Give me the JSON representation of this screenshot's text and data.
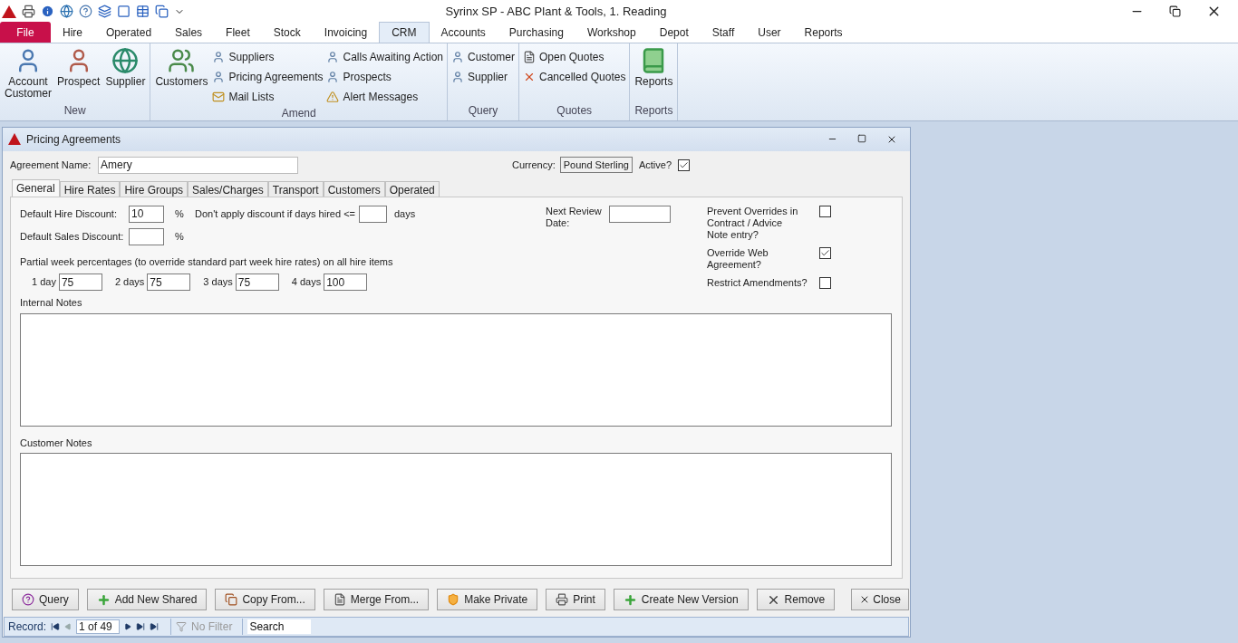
{
  "app_title": "Syrinx SP - ABC Plant & Tools, 1. Reading",
  "menu_tabs": [
    {
      "label": "File",
      "selected": false,
      "kind": "file"
    },
    {
      "label": "Hire",
      "selected": false,
      "kind": "tab"
    },
    {
      "label": "Operated",
      "selected": false,
      "kind": "tab"
    },
    {
      "label": "Sales",
      "selected": false,
      "kind": "tab"
    },
    {
      "label": "Fleet",
      "selected": false,
      "kind": "tab"
    },
    {
      "label": "Stock",
      "selected": false,
      "kind": "tab"
    },
    {
      "label": "Invoicing",
      "selected": false,
      "kind": "tab"
    },
    {
      "label": "CRM",
      "selected": true,
      "kind": "tab"
    },
    {
      "label": "Accounts",
      "selected": false,
      "kind": "tab"
    },
    {
      "label": "Purchasing",
      "selected": false,
      "kind": "tab"
    },
    {
      "label": "Workshop",
      "selected": false,
      "kind": "tab"
    },
    {
      "label": "Depot",
      "selected": false,
      "kind": "tab"
    },
    {
      "label": "Staff",
      "selected": false,
      "kind": "tab"
    },
    {
      "label": "User",
      "selected": false,
      "kind": "tab"
    },
    {
      "label": "Reports",
      "selected": false,
      "kind": "tab"
    }
  ],
  "ribbon_groups": [
    {
      "name": "New",
      "large": [
        "Account\nCustomer",
        "Prospect",
        "Supplier"
      ]
    },
    {
      "name": "Amend",
      "large": [
        "Customers"
      ],
      "small_columns": [
        [
          "Suppliers",
          "Pricing Agreements",
          "Mail Lists"
        ],
        [
          "Calls Awaiting Action",
          "Prospects",
          "Alert Messages"
        ]
      ]
    },
    {
      "name": "Query",
      "small_columns": [
        [
          "Customer",
          "Supplier"
        ]
      ]
    },
    {
      "name": "Quotes",
      "small_columns": [
        [
          "Open Quotes",
          "Cancelled Quotes"
        ]
      ]
    },
    {
      "name": "Reports",
      "large": [
        "Reports"
      ]
    }
  ],
  "window": {
    "title": "Pricing Agreements",
    "agreement_name": {
      "label": "Agreement Name:",
      "value": "Amery"
    },
    "currency": {
      "label": "Currency:",
      "value": "Pound Sterling"
    },
    "active": {
      "label": "Active?",
      "checked": true
    },
    "tabs": [
      {
        "label": "General",
        "selected": true
      },
      {
        "label": "Hire Rates",
        "selected": false
      },
      {
        "label": "Hire Groups",
        "selected": false
      },
      {
        "label": "Sales/Charges",
        "selected": false
      },
      {
        "label": "Transport",
        "selected": false
      },
      {
        "label": "Customers",
        "selected": false
      },
      {
        "label": "Operated",
        "selected": false
      }
    ],
    "general": {
      "hire_discount": {
        "label": "Default Hire Discount:",
        "value": "10",
        "unit": "%"
      },
      "sales_discount": {
        "label": "Default Sales Discount:",
        "unit": "%"
      },
      "days_rule": {
        "label": "Don't apply discount if days hired <=",
        "unit": "days"
      },
      "next_review": {
        "label": "Next Review\nDate:"
      },
      "partial_week_label": "Partial week percentages (to override standard part week hire rates) on all hire items",
      "partial_week": [
        {
          "label": "1 day",
          "value": "75"
        },
        {
          "label": "2 days",
          "value": "75"
        },
        {
          "label": "3 days",
          "value": "75"
        },
        {
          "label": "4 days",
          "value": "100"
        }
      ],
      "options": [
        {
          "label": "Prevent Overrides in\nContract / Advice\nNote entry?",
          "checked": false
        },
        {
          "label": "Override Web\nAgreement?",
          "checked": true
        },
        {
          "label": "Restrict Amendments?",
          "checked": false
        }
      ],
      "internal_notes_label": "Internal Notes",
      "customer_notes_label": "Customer Notes"
    },
    "buttons": [
      {
        "label": "Query",
        "kind": "query"
      },
      {
        "label": "Add New Shared",
        "kind": "add"
      },
      {
        "label": "Copy From...",
        "kind": "copy"
      },
      {
        "label": "Merge From...",
        "kind": "merge"
      },
      {
        "label": "Make Private",
        "kind": "private"
      },
      {
        "label": "Print",
        "kind": "print"
      },
      {
        "label": "Create New Version",
        "kind": "add"
      },
      {
        "label": "Remove",
        "kind": "remove"
      }
    ],
    "close_button": "Close",
    "record_nav": {
      "label": "Record:",
      "position": "1 of 49",
      "filter": "No Filter",
      "search_placeholder": "Search"
    }
  }
}
